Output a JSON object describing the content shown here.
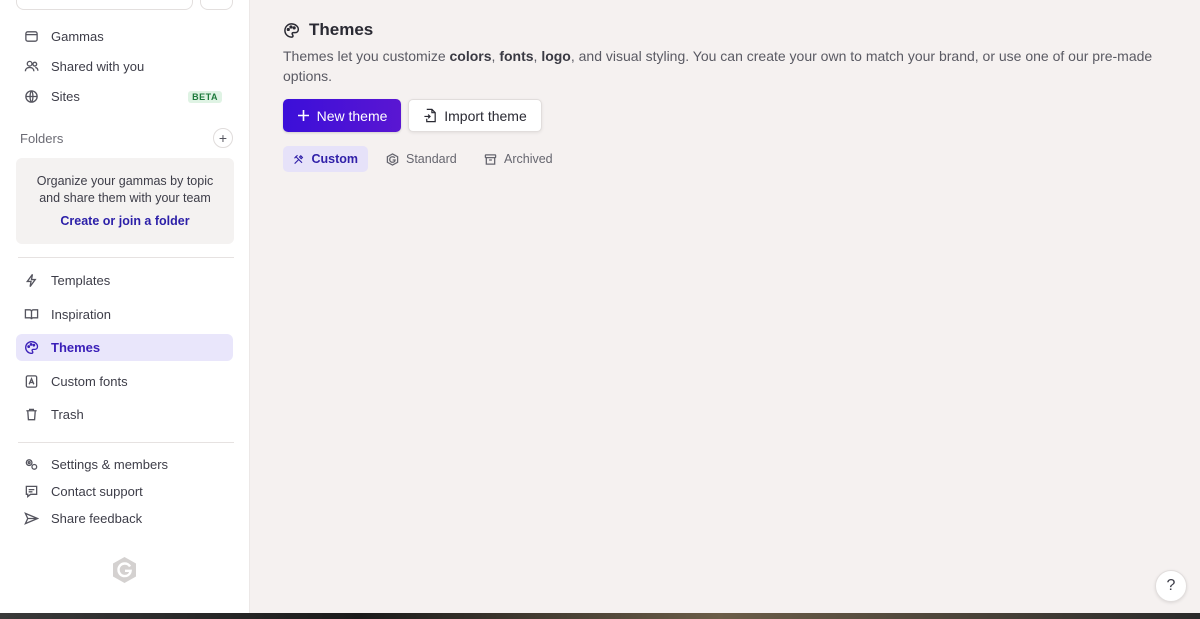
{
  "sidebar": {
    "nav_top": [
      {
        "label": "Gammas",
        "icon": "stack-icon"
      },
      {
        "label": "Shared with you",
        "icon": "users-icon"
      },
      {
        "label": "Sites",
        "icon": "globe-icon",
        "badge": "BETA"
      }
    ],
    "folders": {
      "label": "Folders",
      "add": "+",
      "empty_text": "Organize your gammas by topic and share them with your team",
      "link": "Create or join a folder"
    },
    "nav_mid": [
      {
        "label": "Templates",
        "icon": "bolt-icon"
      },
      {
        "label": "Inspiration",
        "icon": "book-icon"
      },
      {
        "label": "Themes",
        "icon": "palette-icon",
        "active": true
      },
      {
        "label": "Custom fonts",
        "icon": "font-icon"
      },
      {
        "label": "Trash",
        "icon": "trash-icon"
      }
    ],
    "nav_bottom": [
      {
        "label": "Settings & members",
        "icon": "settings-icon"
      },
      {
        "label": "Contact support",
        "icon": "chat-icon"
      },
      {
        "label": "Share feedback",
        "icon": "send-icon"
      }
    ]
  },
  "main": {
    "title": "Themes",
    "description": {
      "p1": "Themes let you customize ",
      "b1": "colors",
      "p2": ", ",
      "b2": "fonts",
      "p3": ", ",
      "b3": "logo",
      "p4": ", and visual styling. You can create your own to match your brand, or use one of our pre-made options."
    },
    "new_theme": "New theme",
    "import_theme": "Import theme",
    "tabs": [
      {
        "label": "Custom",
        "icon": "custom-icon",
        "active": true
      },
      {
        "label": "Standard",
        "icon": "gamma-icon"
      },
      {
        "label": "Archived",
        "icon": "archive-icon"
      }
    ],
    "help": "?"
  },
  "colors": {
    "accent": "#3b0fd9",
    "active_bg": "#e9e6fb",
    "beta_green": "#1e7a3c"
  }
}
